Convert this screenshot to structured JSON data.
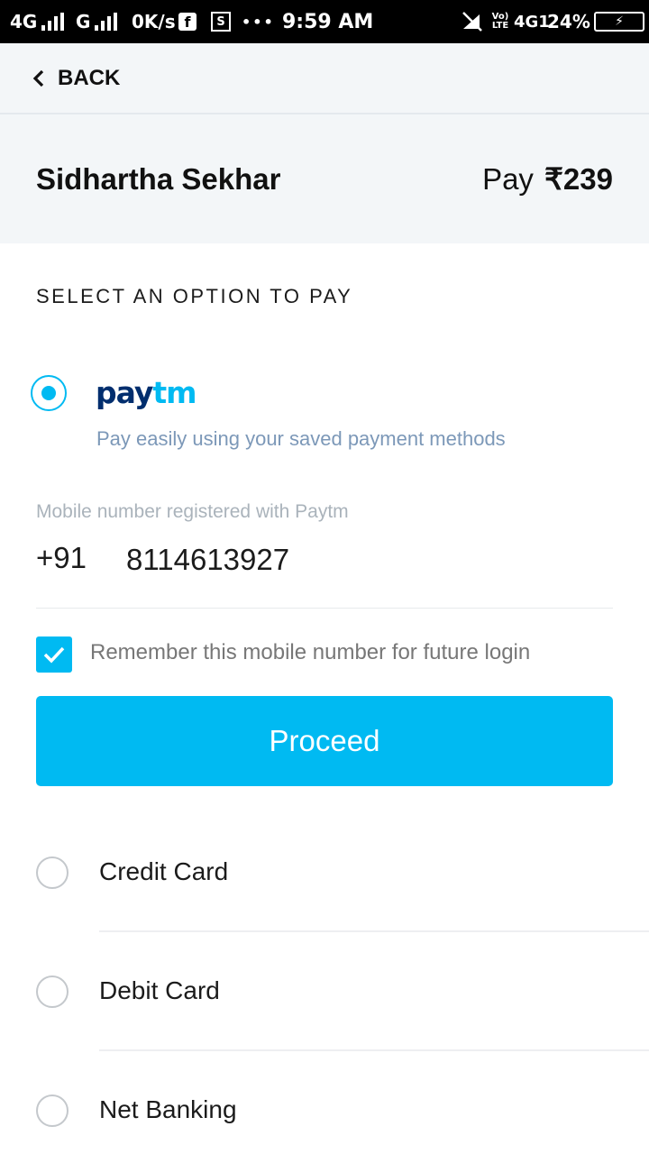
{
  "status_bar": {
    "network_1": "4G",
    "network_2": "G",
    "speed": "0K/s",
    "facebook_icon_label": "f",
    "screenshot_icon_label": "S",
    "more": "•••",
    "time": "9:59 AM",
    "volte": "Vo) LTE",
    "network_3": "4G1",
    "battery_percent": "24%",
    "icons": [
      "signal-icon",
      "facebook-icon",
      "screenshot-icon",
      "mute-icon",
      "battery-icon"
    ]
  },
  "top_bar": {
    "back_label": "BACK",
    "icon": "chevron-left-icon"
  },
  "merchant": {
    "name": "Sidhartha Sekhar",
    "pay_label": "Pay",
    "amount": "₹239"
  },
  "section_title": "SELECT AN OPTION TO PAY",
  "paytm": {
    "logo_part_1": "pay",
    "logo_part_2": "tm",
    "subtitle": "Pay easily using your saved payment methods",
    "selected": true
  },
  "mobile": {
    "label": "Mobile number registered with Paytm",
    "country_code": "+91",
    "number": "8114613927"
  },
  "remember": {
    "label": "Remember this mobile number for future login",
    "checked": true
  },
  "proceed_label": "Proceed",
  "options": [
    {
      "label": "Credit Card"
    },
    {
      "label": "Debit Card"
    },
    {
      "label": "Net Banking"
    }
  ],
  "colors": {
    "accent": "#00baf2",
    "paytm_navy": "#002e6e",
    "header_bg": "#f3f6f8",
    "subtitle": "#7c98b8"
  }
}
